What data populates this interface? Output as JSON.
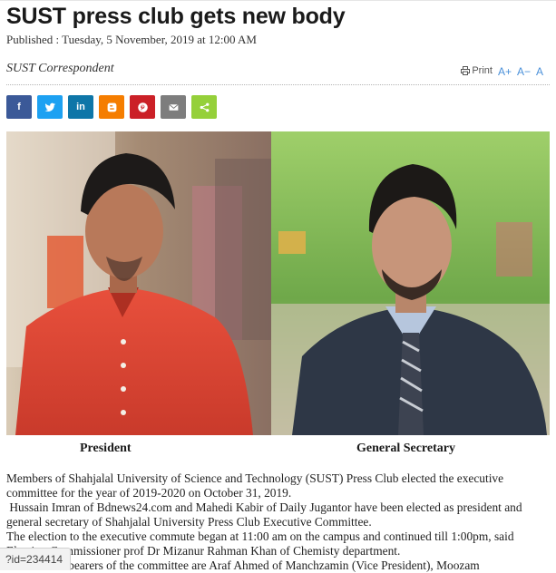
{
  "article": {
    "title": "SUST press club gets new body",
    "published": "Published : Tuesday, 5 November, 2019 at 12:00 AM",
    "byline": "SUST Correspondent"
  },
  "tools": {
    "print_label": "Print",
    "font_increase": "A+",
    "font_decrease": "A−",
    "font_reset": "A"
  },
  "share": [
    {
      "name": "facebook",
      "icon": "facebook-icon",
      "color": "#3b5998",
      "glyph": "f"
    },
    {
      "name": "twitter",
      "icon": "twitter-icon",
      "color": "#1da1f2",
      "glyph": ""
    },
    {
      "name": "linkedin",
      "icon": "linkedin-icon",
      "color": "#0e76a8",
      "glyph": "in"
    },
    {
      "name": "blogger",
      "icon": "blogger-icon",
      "color": "#f57d00",
      "glyph": ""
    },
    {
      "name": "pinterest",
      "icon": "pinterest-icon",
      "color": "#cb2027",
      "glyph": ""
    },
    {
      "name": "email",
      "icon": "email-icon",
      "color": "#7d7d7d",
      "glyph": ""
    },
    {
      "name": "sharethis",
      "icon": "sharethis-icon",
      "color": "#95d03a",
      "glyph": ""
    }
  ],
  "photo": {
    "left_caption": "President",
    "right_caption": "General Secretary"
  },
  "body": {
    "p1": "Members of Shahjalal University of Science and Technology (SUST) Press Club elected the executive committee for the year of 2019-2020 on October 31, 2019.",
    "p2": "Hussain Imran of Bdnews24.com and Mahedi Kabir of Daily Jugantor have been elected as president and general secretary of Shahjalal University Press Club Executive Committee.",
    "p3": "The election to the executive commute began at 11:00 am on the campus and continued till 1:00pm, said Election Commissioner prof Dr Mizanur Rahman Khan of Chemisty department.",
    "p4": "Other office bearers of the committee are Araf Ahmed of Manchzamin (Vice President), Moozam"
  },
  "status_bar": {
    "url_fragment": "?id=234414"
  }
}
